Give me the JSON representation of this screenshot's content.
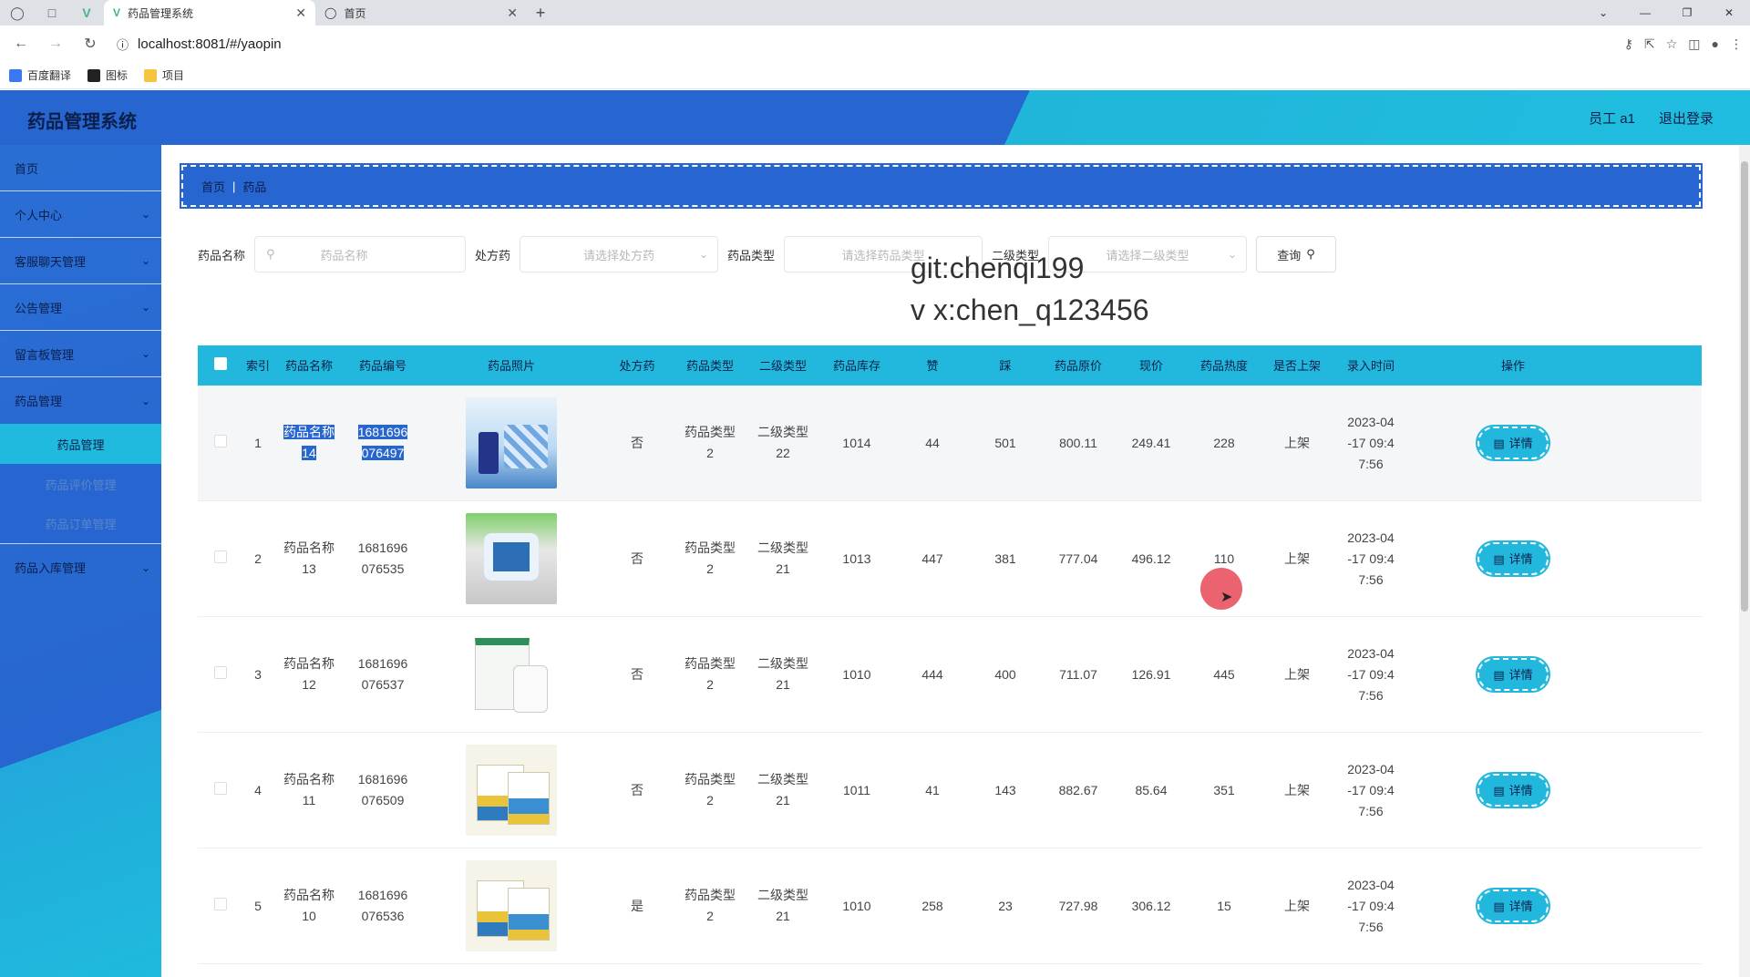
{
  "browser": {
    "tabs": [
      {
        "title": "药品管理系统",
        "active": true
      },
      {
        "title": "首页",
        "active": false
      }
    ],
    "url": "localhost:8081/#/yaopin",
    "bookmarks": [
      "百度翻译",
      "图标",
      "项目"
    ]
  },
  "header": {
    "title": "药品管理系统",
    "user": "员工 a1",
    "logout": "退出登录"
  },
  "sidebar": {
    "items": [
      {
        "label": "首页"
      },
      {
        "label": "个人中心"
      },
      {
        "label": "客服聊天管理"
      },
      {
        "label": "公告管理"
      },
      {
        "label": "留言板管理"
      },
      {
        "label": "药品管理"
      },
      {
        "label": "药品入库管理"
      }
    ],
    "sub_items": [
      {
        "label": "药品管理"
      },
      {
        "label": "药品评价管理"
      },
      {
        "label": "药品订单管理"
      }
    ]
  },
  "breadcrumb": {
    "home": "首页",
    "sep": "|",
    "current": "药品"
  },
  "search": {
    "name_label": "药品名称",
    "name_placeholder": "药品名称",
    "rx_label": "处方药",
    "rx_placeholder": "请选择处方药",
    "type_label": "药品类型",
    "type_placeholder": "请选择药品类型",
    "subtype_label": "二级类型",
    "subtype_placeholder": "请选择二级类型",
    "query_label": "查询"
  },
  "watermark": {
    "line1": "git:chenqi199",
    "line2": "v x:chen_q123456"
  },
  "table": {
    "headers": [
      "索引",
      "药品名称",
      "药品编号",
      "药品照片",
      "处方药",
      "药品类型",
      "二级类型",
      "药品库存",
      "赞",
      "踩",
      "药品原价",
      "现价",
      "药品热度",
      "是否上架",
      "录入时间",
      "操作"
    ],
    "detail_label": "详情",
    "rows": [
      {
        "idx": "1",
        "name1": "药品名称",
        "name2": "14",
        "code1": "1681696",
        "code2": "076497",
        "rx": "否",
        "type1": "药品类型",
        "type2": "2",
        "sub1": "二级类型",
        "sub2": "22",
        "stock": "1014",
        "up": "44",
        "down": "501",
        "orig": "800.11",
        "price": "249.41",
        "hot": "228",
        "shelf": "上架",
        "t1": "2023-04",
        "t2": "-17 09:4",
        "t3": "7:56"
      },
      {
        "idx": "2",
        "name1": "药品名称",
        "name2": "13",
        "code1": "1681696",
        "code2": "076535",
        "rx": "否",
        "type1": "药品类型",
        "type2": "2",
        "sub1": "二级类型",
        "sub2": "21",
        "stock": "1013",
        "up": "447",
        "down": "381",
        "orig": "777.04",
        "price": "496.12",
        "hot": "110",
        "shelf": "上架",
        "t1": "2023-04",
        "t2": "-17 09:4",
        "t3": "7:56"
      },
      {
        "idx": "3",
        "name1": "药品名称",
        "name2": "12",
        "code1": "1681696",
        "code2": "076537",
        "rx": "否",
        "type1": "药品类型",
        "type2": "2",
        "sub1": "二级类型",
        "sub2": "21",
        "stock": "1010",
        "up": "444",
        "down": "400",
        "orig": "711.07",
        "price": "126.91",
        "hot": "445",
        "shelf": "上架",
        "t1": "2023-04",
        "t2": "-17 09:4",
        "t3": "7:56"
      },
      {
        "idx": "4",
        "name1": "药品名称",
        "name2": "11",
        "code1": "1681696",
        "code2": "076509",
        "rx": "否",
        "type1": "药品类型",
        "type2": "2",
        "sub1": "二级类型",
        "sub2": "21",
        "stock": "1011",
        "up": "41",
        "down": "143",
        "orig": "882.67",
        "price": "85.64",
        "hot": "351",
        "shelf": "上架",
        "t1": "2023-04",
        "t2": "-17 09:4",
        "t3": "7:56"
      },
      {
        "idx": "5",
        "name1": "药品名称",
        "name2": "10",
        "code1": "1681696",
        "code2": "076536",
        "rx": "是",
        "type1": "药品类型",
        "type2": "2",
        "sub1": "二级类型",
        "sub2": "21",
        "stock": "1010",
        "up": "258",
        "down": "23",
        "orig": "727.98",
        "price": "306.12",
        "hot": "15",
        "shelf": "上架",
        "t1": "2023-04",
        "t2": "-17 09:4",
        "t3": "7:56"
      }
    ]
  }
}
